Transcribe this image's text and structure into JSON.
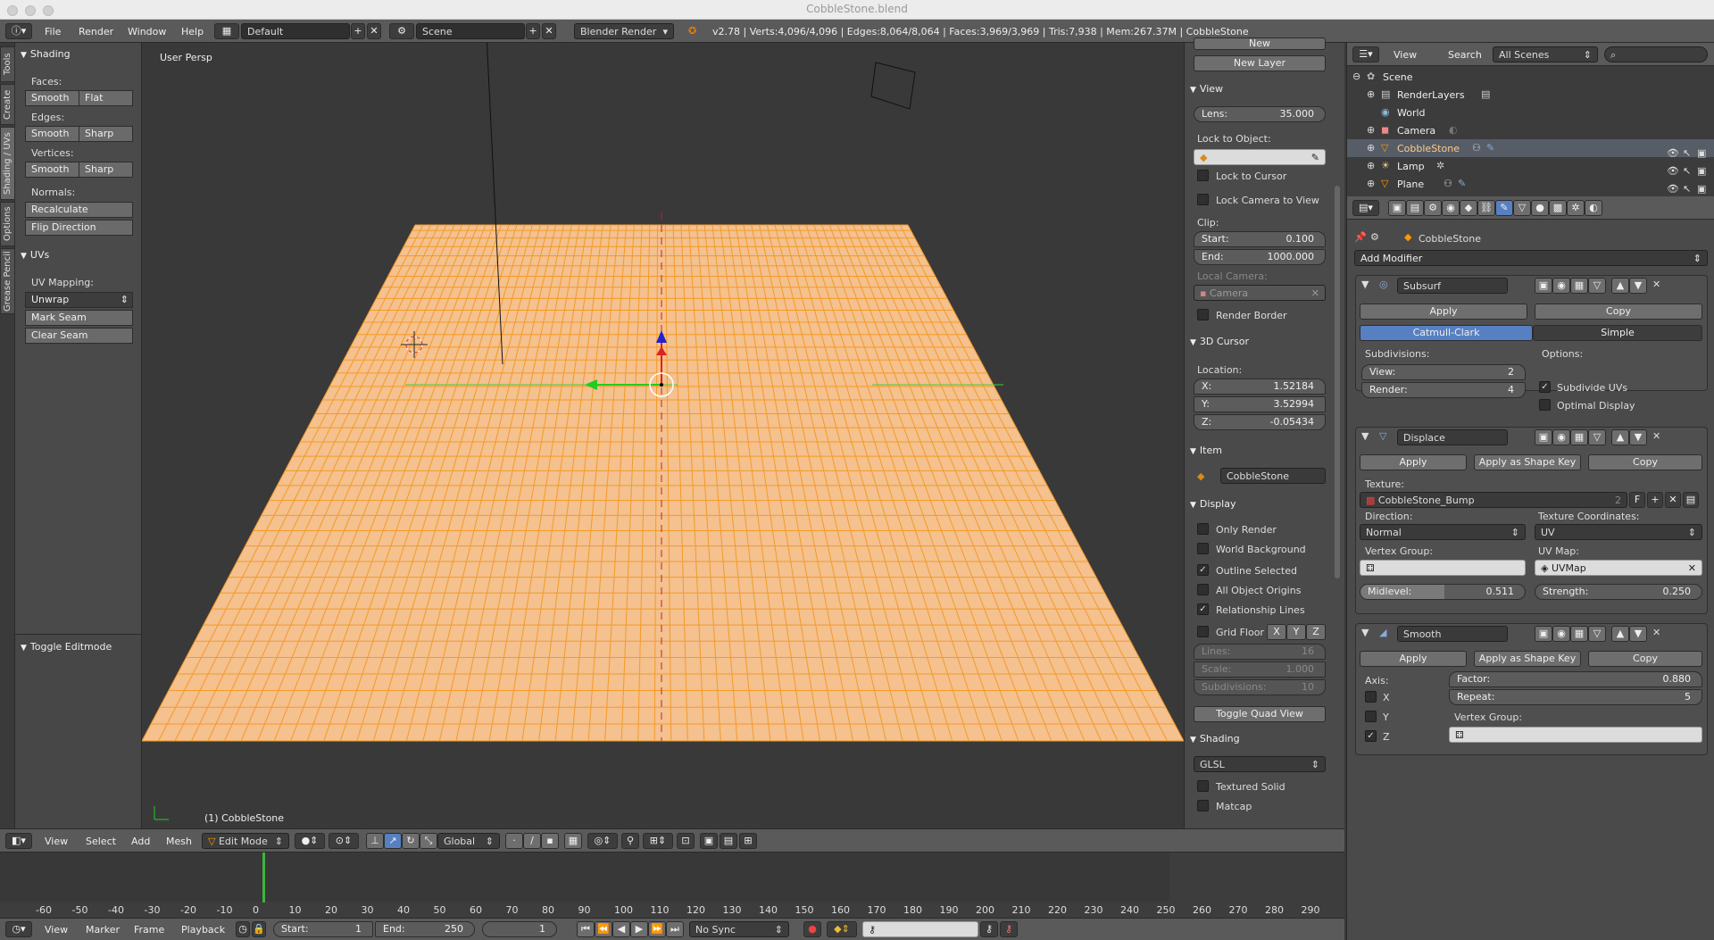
{
  "window": {
    "title": "CobbleStone.blend"
  },
  "info": {
    "menus": [
      "File",
      "Render",
      "Window",
      "Help"
    ],
    "layout": "Default",
    "scene": "Scene",
    "engine": "Blender Render",
    "stats": "v2.78 | Verts:4,096/4,096 | Edges:8,064/8,064 | Faces:3,969/3,969 | Tris:7,938 | Mem:267.37M | CobbleStone"
  },
  "tabs": [
    "Tools",
    "Create",
    "Shading / UVs",
    "Options",
    "Grease Pencil"
  ],
  "toolshelf": {
    "shading_title": "Shading",
    "faces_label": "Faces:",
    "faces": [
      "Smooth",
      "Flat"
    ],
    "edges_label": "Edges:",
    "edges": [
      "Smooth",
      "Sharp"
    ],
    "vertices_label": "Vertices:",
    "vertices": [
      "Smooth",
      "Sharp"
    ],
    "normals_label": "Normals:",
    "recalculate": "Recalculate",
    "flip": "Flip Direction",
    "uvs_title": "UVs",
    "uvmap_label": "UV Mapping:",
    "unwrap": "Unwrap",
    "mark_seam": "Mark Seam",
    "clear_seam": "Clear Seam",
    "toggle_editmode": "Toggle Editmode"
  },
  "viewport": {
    "label": "User Persp",
    "object": "(1) CobbleStone"
  },
  "npanel": {
    "new_label": "New",
    "new_layer": "New Layer",
    "view_title": "View",
    "lens_label": "Lens:",
    "lens": "35.000",
    "lock_obj": "Lock to Object:",
    "lock_cursor": "Lock to Cursor",
    "lock_cam": "Lock Camera to View",
    "clip": "Clip:",
    "start_label": "Start:",
    "start": "0.100",
    "end_label": "End:",
    "end": "1000.000",
    "local_cam": "Local Camera:",
    "camera": "Camera",
    "render_border": "Render Border",
    "cursor_title": "3D Cursor",
    "location": "Location:",
    "x_label": "X:",
    "x": "1.52184",
    "y_label": "Y:",
    "y": "3.52994",
    "z_label": "Z:",
    "z": "-0.05434",
    "item_title": "Item",
    "item_name": "CobbleStone",
    "display_title": "Display",
    "only_render": "Only Render",
    "world_bg": "World Background",
    "outline_sel": "Outline Selected",
    "all_origins": "All Object Origins",
    "rel_lines": "Relationship Lines",
    "grid_floor": "Grid Floor",
    "axes": [
      "X",
      "Y",
      "Z"
    ],
    "lines_label": "Lines:",
    "lines": "16",
    "scale_label": "Scale:",
    "scale": "1.000",
    "subdiv_label": "Subdivisions:",
    "subdiv": "10",
    "toggle_quad": "Toggle Quad View",
    "shading_title": "Shading",
    "glsl": "GLSL",
    "textured_solid": "Textured Solid",
    "matcap": "Matcap"
  },
  "outliner": {
    "menus": [
      "View",
      "Search"
    ],
    "scenes": "All Scenes",
    "items": [
      "Scene",
      "RenderLayers",
      "World",
      "Camera",
      "CobbleStone",
      "Lamp",
      "Plane"
    ]
  },
  "props": {
    "object": "CobbleStone",
    "add_modifier": "Add Modifier",
    "subsurf": {
      "name": "Subsurf",
      "apply": "Apply",
      "copy": "Copy",
      "catmull": "Catmull-Clark",
      "simple": "Simple",
      "subdivisions": "Subdivisions:",
      "options": "Options:",
      "view_label": "View:",
      "view": "2",
      "render_label": "Render:",
      "render": "4",
      "subdivide_uvs": "Subdivide UVs",
      "optimal": "Optimal Display"
    },
    "displace": {
      "name": "Displace",
      "apply": "Apply",
      "apply_shape": "Apply as Shape Key",
      "copy": "Copy",
      "texture_label": "Texture:",
      "texture": "CobbleStone_Bump",
      "tex_users": "2",
      "tex_f": "F",
      "direction_label": "Direction:",
      "direction": "Normal",
      "texcoord_label": "Texture Coordinates:",
      "texcoord": "UV",
      "vgroup_label": "Vertex Group:",
      "uvmap_label": "UV Map:",
      "uvmap": "UVMap",
      "midlevel_label": "Midlevel:",
      "midlevel": "0.511",
      "midlevel_frac": 0.511,
      "strength_label": "Strength:",
      "strength": "0.250"
    },
    "smooth": {
      "name": "Smooth",
      "apply": "Apply",
      "apply_shape": "Apply as Shape Key",
      "copy": "Copy",
      "axis_label": "Axis:",
      "x": "X",
      "y": "Y",
      "z": "Z",
      "factor_label": "Factor:",
      "factor": "0.880",
      "repeat_label": "Repeat:",
      "repeat": "5",
      "vgroup_label": "Vertex Group:"
    }
  },
  "vheader": {
    "menus": [
      "View",
      "Select",
      "Add",
      "Mesh"
    ],
    "mode": "Edit Mode",
    "orientation": "Global"
  },
  "timeline": {
    "ticks": [
      "-60",
      "-50",
      "-40",
      "-30",
      "-20",
      "-10",
      "0",
      "10",
      "20",
      "30",
      "40",
      "50",
      "60",
      "70",
      "80",
      "90",
      "100",
      "110",
      "120",
      "130",
      "140",
      "150",
      "160",
      "170",
      "180",
      "190",
      "200",
      "210",
      "220",
      "230",
      "240",
      "250",
      "260",
      "270",
      "280",
      "290"
    ],
    "menus": [
      "View",
      "Marker",
      "Frame",
      "Playback"
    ],
    "start_label": "Start:",
    "start": "1",
    "end_label": "End:",
    "end": "250",
    "current": "1",
    "sync": "No Sync"
  },
  "colors": {
    "accent": "#5680c2",
    "mesh": "#f7a94b",
    "mesh_face": "#f4c08b"
  }
}
